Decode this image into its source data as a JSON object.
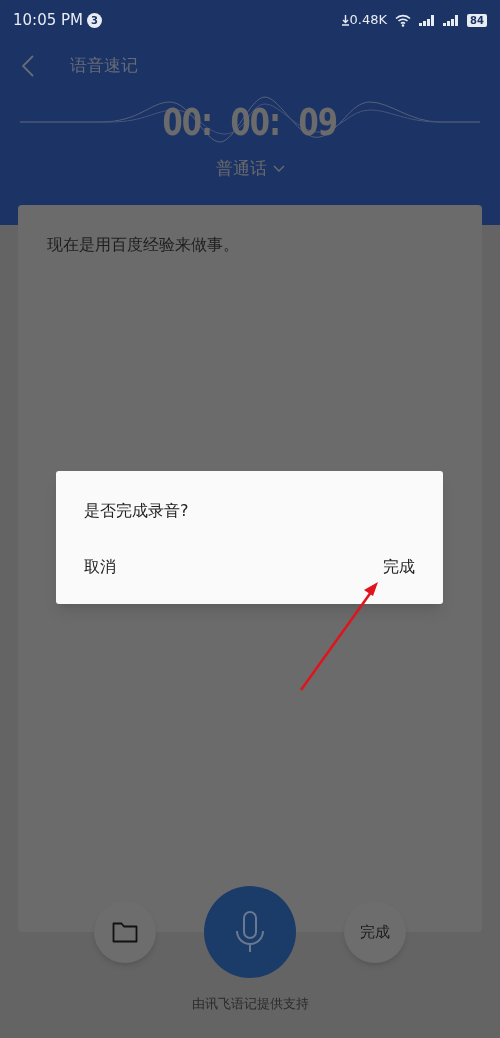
{
  "status_bar": {
    "time": "10:05 PM",
    "notification_count": "3",
    "net_speed": "0.48K",
    "battery": "84"
  },
  "header": {
    "title": "语音速记",
    "timer": "00:  00:  09",
    "language": "普通话"
  },
  "transcript": {
    "text": "现在是用百度经验来做事。"
  },
  "dialog": {
    "message": "是否完成录音?",
    "buttons": [
      {
        "label": "取消"
      },
      {
        "label": "完成"
      }
    ]
  },
  "controls": {
    "finish_label": "完成"
  },
  "footer": "由讯飞语记提供支持"
}
